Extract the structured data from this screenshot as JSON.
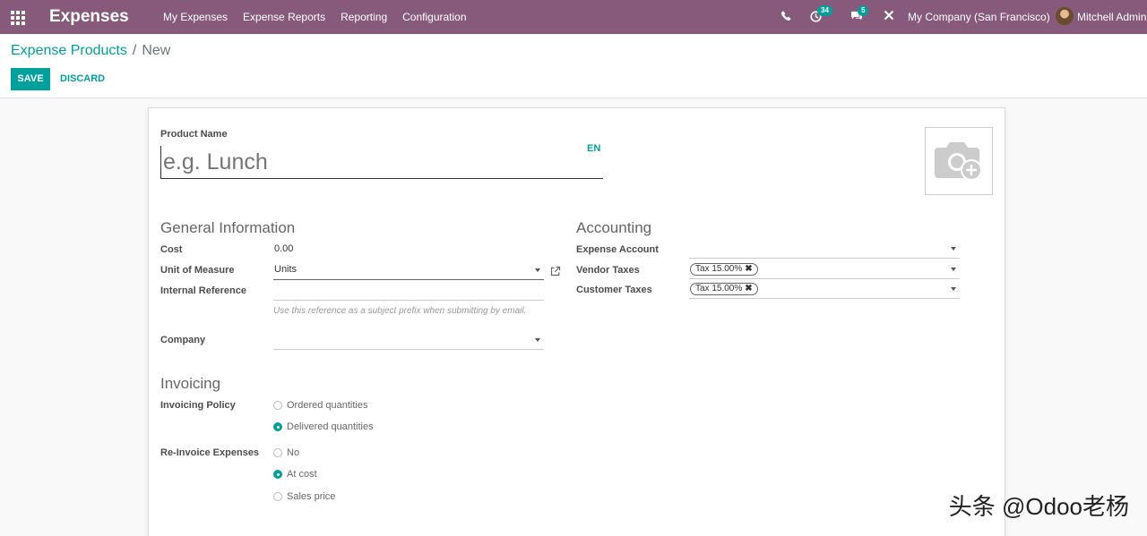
{
  "navbar": {
    "app_title": "Expenses",
    "menu": [
      "My Expenses",
      "Expense Reports",
      "Reporting",
      "Configuration"
    ],
    "activity_count": "34",
    "messages_count": "5",
    "company": "My Company (San Francisco)",
    "user": "Mitchell Admin",
    "color": "#875a7b"
  },
  "breadcrumb": {
    "parent": "Expense Products",
    "separator": "/",
    "current": "New"
  },
  "buttons": {
    "save": "SAVE",
    "discard": "DISCARD"
  },
  "product": {
    "name_label": "Product Name",
    "name_placeholder": "e.g. Lunch",
    "lang": "EN"
  },
  "general": {
    "title": "General Information",
    "cost_label": "Cost",
    "cost_value": "0.00",
    "uom_label": "Unit of Measure",
    "uom_value": "Units",
    "ref_label": "Internal Reference",
    "ref_value": "",
    "ref_hint": "Use this reference as a subject prefix when submitting by email.",
    "company_label": "Company",
    "company_value": ""
  },
  "accounting": {
    "title": "Accounting",
    "expense_account_label": "Expense Account",
    "vendor_taxes_label": "Vendor Taxes",
    "vendor_tax_tag": "Tax 15.00%",
    "customer_taxes_label": "Customer Taxes",
    "customer_tax_tag": "Tax 15.00%"
  },
  "invoicing": {
    "title": "Invoicing",
    "policy_label": "Invoicing Policy",
    "policy_options": [
      "Ordered quantities",
      "Delivered quantities"
    ],
    "policy_selected": "Delivered quantities",
    "reinvoice_label": "Re-Invoice Expenses",
    "reinvoice_options": [
      "No",
      "At cost",
      "Sales price"
    ],
    "reinvoice_selected": "At cost"
  },
  "watermark": "头条 @Odoo老杨",
  "colors": {
    "accent": "#00a09d",
    "brand": "#875a7b"
  }
}
